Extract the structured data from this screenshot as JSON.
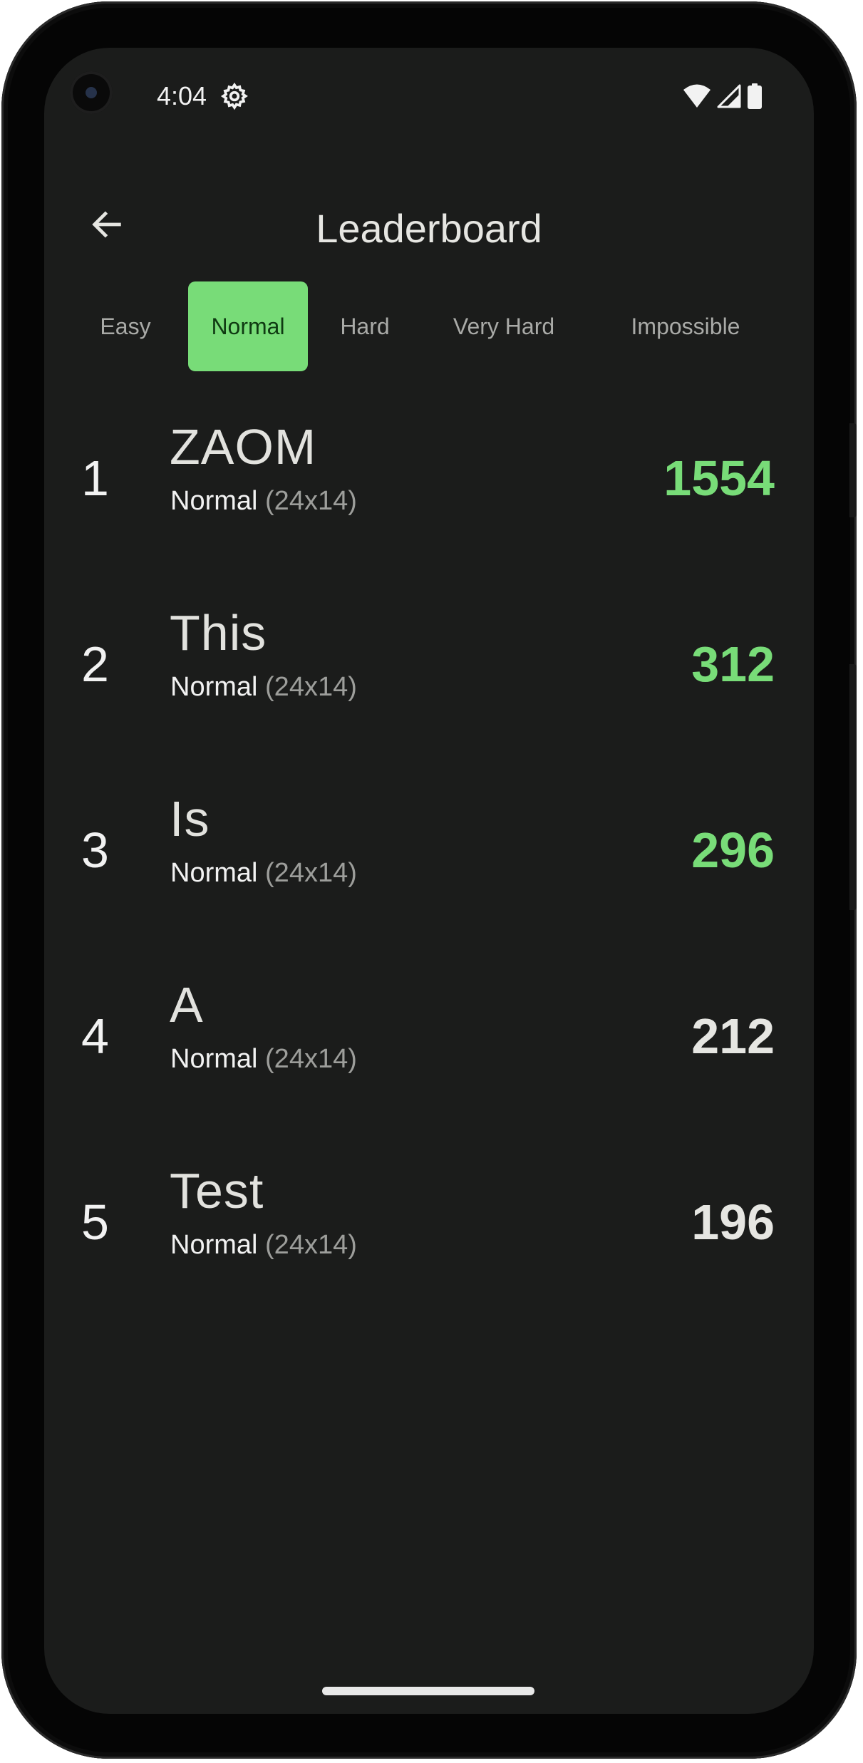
{
  "status_bar": {
    "time": "4:04",
    "icons": [
      "settings-gear-icon",
      "wifi-icon",
      "signal-icon",
      "battery-icon"
    ]
  },
  "app_bar": {
    "title": "Leaderboard",
    "back_icon": "arrow-left-icon"
  },
  "tabs": [
    {
      "label": "Easy",
      "active": false
    },
    {
      "label": "Normal",
      "active": true
    },
    {
      "label": "Hard",
      "active": false
    },
    {
      "label": "Very Hard",
      "active": false
    },
    {
      "label": "Impossible",
      "active": false
    }
  ],
  "entries": [
    {
      "rank": "1",
      "name": "ZAOM",
      "mode": "Normal",
      "size": "(24x14)",
      "score": "1554",
      "highlight": true
    },
    {
      "rank": "2",
      "name": "This",
      "mode": "Normal",
      "size": "(24x14)",
      "score": "312",
      "highlight": true
    },
    {
      "rank": "3",
      "name": "Is",
      "mode": "Normal",
      "size": "(24x14)",
      "score": "296",
      "highlight": true
    },
    {
      "rank": "4",
      "name": "A",
      "mode": "Normal",
      "size": "(24x14)",
      "score": "212",
      "highlight": false
    },
    {
      "rank": "5",
      "name": "Test",
      "mode": "Normal",
      "size": "(24x14)",
      "score": "196",
      "highlight": false
    }
  ],
  "colors": {
    "background": "#1b1c1b",
    "accent": "#78dc78",
    "text_primary": "#f2f2f2",
    "text_secondary": "#9d9e9b"
  }
}
